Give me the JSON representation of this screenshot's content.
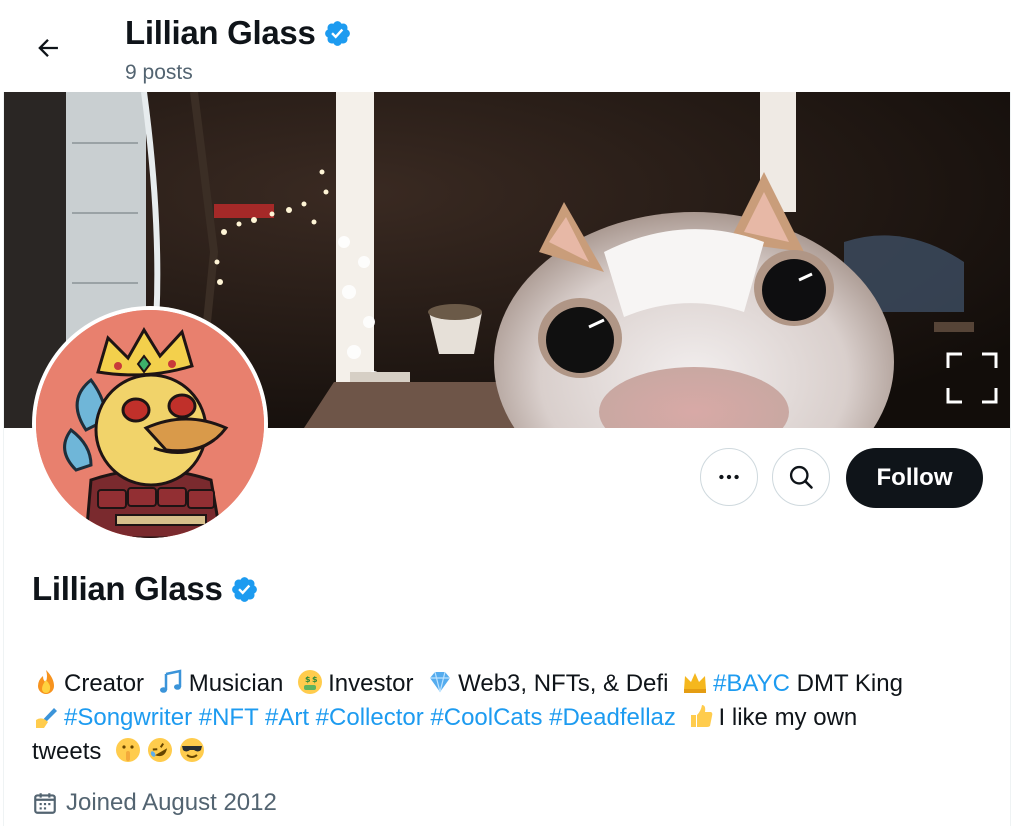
{
  "header": {
    "name": "Lillian Glass",
    "post_count": "9 posts"
  },
  "profile": {
    "display_name": "Lillian Glass",
    "joined": "Joined August 2012"
  },
  "actions": {
    "follow_label": "Follow"
  },
  "bio": {
    "creator": "Creator",
    "musician": "Musician",
    "investor": "Investor",
    "web3": "Web3, NFTs, & Defi",
    "bayc": "#BAYC",
    "dmt_king": "DMT King",
    "songwriter": "#Songwriter",
    "nft": "#NFT",
    "art": "#Art",
    "collector": "#Collector",
    "coolcats": "#CoolCats",
    "deadfellaz": "#Deadfellaz",
    "like_own": "I like my own",
    "tweets": "tweets"
  },
  "icons": {
    "back": "arrow-left-icon",
    "verified": "verified-badge-icon",
    "more": "more-horizontal-icon",
    "search": "search-icon",
    "expand": "fullscreen-icon",
    "calendar": "calendar-icon"
  },
  "colors": {
    "link": "#1d9bf0",
    "follow_bg": "#0f1419",
    "secondary_text": "#536471",
    "avatar_bg": "#e8806e"
  }
}
